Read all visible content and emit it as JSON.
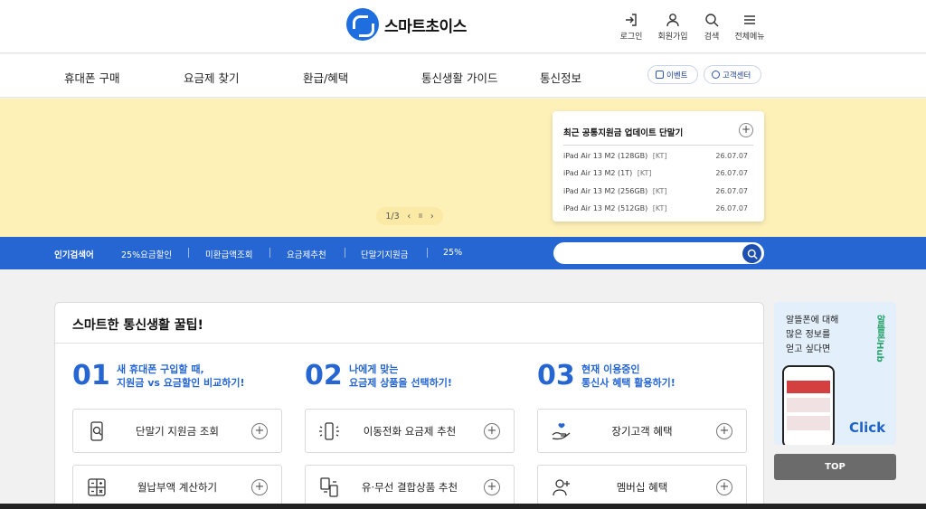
{
  "header": {
    "logo_text": "스마트초이스",
    "util": [
      {
        "label": "로그인",
        "icon": "login-icon"
      },
      {
        "label": "회원가입",
        "icon": "user-icon"
      },
      {
        "label": "검색",
        "icon": "search-icon"
      },
      {
        "label": "전체메뉴",
        "icon": "menu-icon"
      }
    ]
  },
  "nav": {
    "items": [
      "휴대폰 구매",
      "요금제 찾기",
      "환급/혜택",
      "통신생활 가이드",
      "통신정보"
    ],
    "event_btn": "이벤트",
    "cs_btn": "고객센터"
  },
  "banner": {
    "pager": {
      "page": "1/3",
      "prev": "‹",
      "pause": "II",
      "next": "›"
    },
    "card": {
      "title": "최근 공통지원금 업데이트 단말기",
      "plus": "+",
      "rows": [
        {
          "name": "iPad Air 13 M2 (128GB)",
          "carrier": "[KT]",
          "date": "26.07.07"
        },
        {
          "name": "iPad Air 13 M2 (1T)",
          "carrier": "[KT]",
          "date": "26.07.07"
        },
        {
          "name": "iPad Air 13 M2 (256GB)",
          "carrier": "[KT]",
          "date": "26.07.07"
        },
        {
          "name": "iPad Air 13 M2 (512GB)",
          "carrier": "[KT]",
          "date": "26.07.07"
        }
      ]
    }
  },
  "search": {
    "popular_label": "인기검색어",
    "keywords": [
      "25%요금할인",
      "미환급액조회",
      "요금제추천",
      "단말기지원금",
      "25%"
    ],
    "placeholder": ""
  },
  "tips": {
    "title": "스마트한 통신생활 꿀팁!",
    "columns": [
      {
        "num": "01",
        "line1": "새 휴대폰 구입할 때,",
        "line2": "지원금 vs 요금할인 비교하기!",
        "boxes": [
          {
            "label": "단말기 지원금 조회",
            "icon": "phone-search-icon"
          },
          {
            "label": "월납부액 계산하기",
            "icon": "calculator-icon"
          }
        ]
      },
      {
        "num": "02",
        "line1": "나에게 맞는",
        "line2": "요금제 상품을 선택하기!",
        "boxes": [
          {
            "label": "이동전화 요금제 추천",
            "icon": "mobile-signal-icon"
          },
          {
            "label": "유·무선 결합상품 추천",
            "icon": "bundle-icon"
          }
        ]
      },
      {
        "num": "03",
        "line1": "현재 이용중인",
        "line2": "통신사 혜택 활용하기!",
        "boxes": [
          {
            "label": "장기고객 혜택",
            "icon": "heart-hand-icon"
          },
          {
            "label": "멤버십 혜택",
            "icon": "user-plus-icon"
          }
        ]
      }
    ]
  },
  "side": {
    "ad_line1": "알뜰폰에 대해",
    "ad_line2": "많은 정보를",
    "ad_line3": "얻고 싶다면",
    "ad_logo": "알뜰폰Hub",
    "ad_click": "Click",
    "top_btn": "TOP"
  },
  "colors": {
    "primary": "#2566d2",
    "banner": "#fdf1b8",
    "accent_green": "#2aa36c"
  }
}
